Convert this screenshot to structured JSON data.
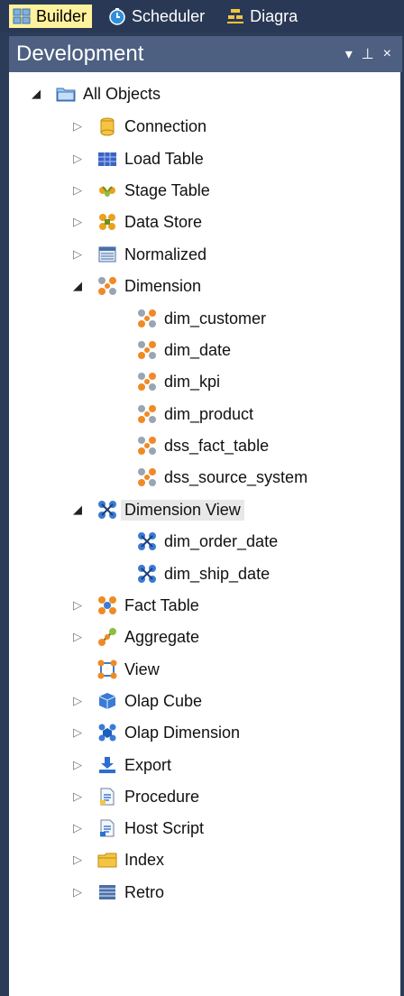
{
  "tabs": [
    {
      "label": "Builder",
      "active": true,
      "icon": "builder-icon"
    },
    {
      "label": "Scheduler",
      "active": false,
      "icon": "clock-icon"
    },
    {
      "label": "Diagra",
      "active": false,
      "icon": "diagram-icon"
    }
  ],
  "panel": {
    "title": "Development",
    "controls": {
      "dropdown": "▾",
      "pin": "⊥",
      "close": "×"
    }
  },
  "tree": {
    "root": {
      "label": "All Objects",
      "expanded": true
    },
    "items": [
      {
        "label": "Connection",
        "icon": "connection-icon",
        "expanded": false
      },
      {
        "label": "Load Table",
        "icon": "load-table-icon",
        "expanded": false
      },
      {
        "label": "Stage Table",
        "icon": "stage-table-icon",
        "expanded": false
      },
      {
        "label": "Data Store",
        "icon": "data-store-icon",
        "expanded": false
      },
      {
        "label": "Normalized",
        "icon": "normalized-icon",
        "expanded": false
      },
      {
        "label": "Dimension",
        "icon": "dimension-icon",
        "expanded": true,
        "children": [
          "dim_customer",
          "dim_date",
          "dim_kpi",
          "dim_product",
          "dss_fact_table",
          "dss_source_system"
        ]
      },
      {
        "label": "Dimension View",
        "icon": "dimension-view-icon",
        "expanded": true,
        "selected": true,
        "children": [
          "dim_order_date",
          "dim_ship_date"
        ]
      },
      {
        "label": "Fact Table",
        "icon": "fact-table-icon",
        "expanded": false
      },
      {
        "label": "Aggregate",
        "icon": "aggregate-icon",
        "expanded": false
      },
      {
        "label": "View",
        "icon": "view-icon",
        "expanded": null
      },
      {
        "label": "Olap Cube",
        "icon": "olap-cube-icon",
        "expanded": false
      },
      {
        "label": "Olap Dimension",
        "icon": "olap-dimension-icon",
        "expanded": false
      },
      {
        "label": "Export",
        "icon": "export-icon",
        "expanded": false
      },
      {
        "label": "Procedure",
        "icon": "procedure-icon",
        "expanded": false
      },
      {
        "label": "Host Script",
        "icon": "host-script-icon",
        "expanded": false
      },
      {
        "label": "Index",
        "icon": "index-icon",
        "expanded": false
      },
      {
        "label": "Retro",
        "icon": "retro-icon",
        "expanded": false
      }
    ]
  },
  "colors": {
    "window_bg": "#2b3c59",
    "active_tab": "#fff29d",
    "panel_title_bg": "#4d6082",
    "selected_bg": "#e8e8e8"
  }
}
